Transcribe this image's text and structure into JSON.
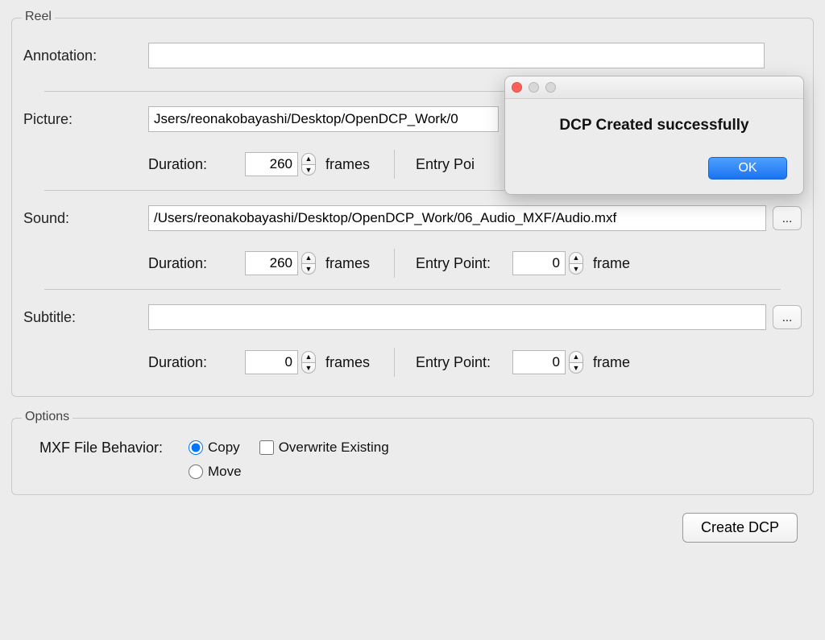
{
  "reel": {
    "title": "Reel",
    "annotation": {
      "label": "Annotation:",
      "value": ""
    },
    "picture": {
      "label": "Picture:",
      "path": "Jsers/reonakobayashi/Desktop/OpenDCP_Work/0",
      "browse": "...",
      "duration_label": "Duration:",
      "duration_value": "260",
      "duration_unit": "frames",
      "entry_label": "Entry Poi"
    },
    "sound": {
      "label": "Sound:",
      "path": "/Users/reonakobayashi/Desktop/OpenDCP_Work/06_Audio_MXF/Audio.mxf",
      "browse": "...",
      "duration_label": "Duration:",
      "duration_value": "260",
      "duration_unit": "frames",
      "entry_label": "Entry Point:",
      "entry_value": "0",
      "entry_unit": "frame"
    },
    "subtitle": {
      "label": "Subtitle:",
      "path": "",
      "browse": "...",
      "duration_label": "Duration:",
      "duration_value": "0",
      "duration_unit": "frames",
      "entry_label": "Entry Point:",
      "entry_value": "0",
      "entry_unit": "frame"
    }
  },
  "options": {
    "title": "Options",
    "mxf_label": "MXF File Behavior:",
    "copy": "Copy",
    "move": "Move",
    "overwrite": "Overwrite Existing",
    "selected": "copy",
    "overwrite_checked": false
  },
  "create_button": "Create DCP",
  "dialog": {
    "message": "DCP Created successfully",
    "ok": "OK"
  }
}
